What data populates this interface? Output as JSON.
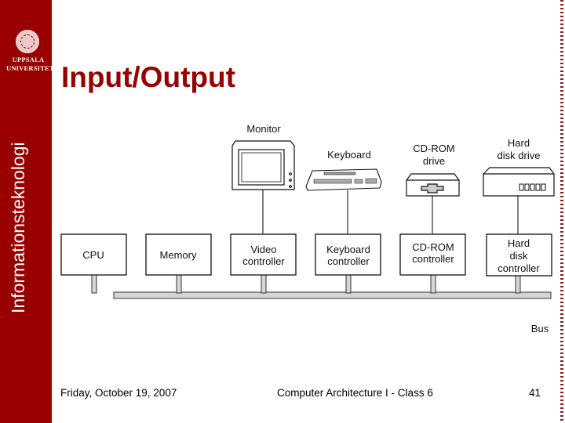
{
  "sidebar": {
    "university_line1": "UPPSALA",
    "university_line2": "UNIVERSITET",
    "department": "Informationsteknologi",
    "brand_color": "#990000"
  },
  "slide": {
    "title": "Input/Output"
  },
  "diagram": {
    "devices": {
      "monitor": "Monitor",
      "keyboard": "Keyboard",
      "cdrom_line1": "CD-ROM",
      "cdrom_line2": "drive",
      "harddisk_line1": "Hard",
      "harddisk_line2": "disk drive"
    },
    "boxes": {
      "cpu": "CPU",
      "memory": "Memory",
      "video_line1": "Video",
      "video_line2": "controller",
      "keyboard_line1": "Keyboard",
      "keyboard_line2": "controller",
      "cdrom_line1": "CD-ROM",
      "cdrom_line2": "controller",
      "hd_line1": "Hard",
      "hd_line2": "disk",
      "hd_line3": "controller"
    },
    "bus_label": "Bus"
  },
  "footer": {
    "date": "Friday, October 19, 2007",
    "course": "Computer Architecture I - Class 6",
    "page_number": "41"
  }
}
